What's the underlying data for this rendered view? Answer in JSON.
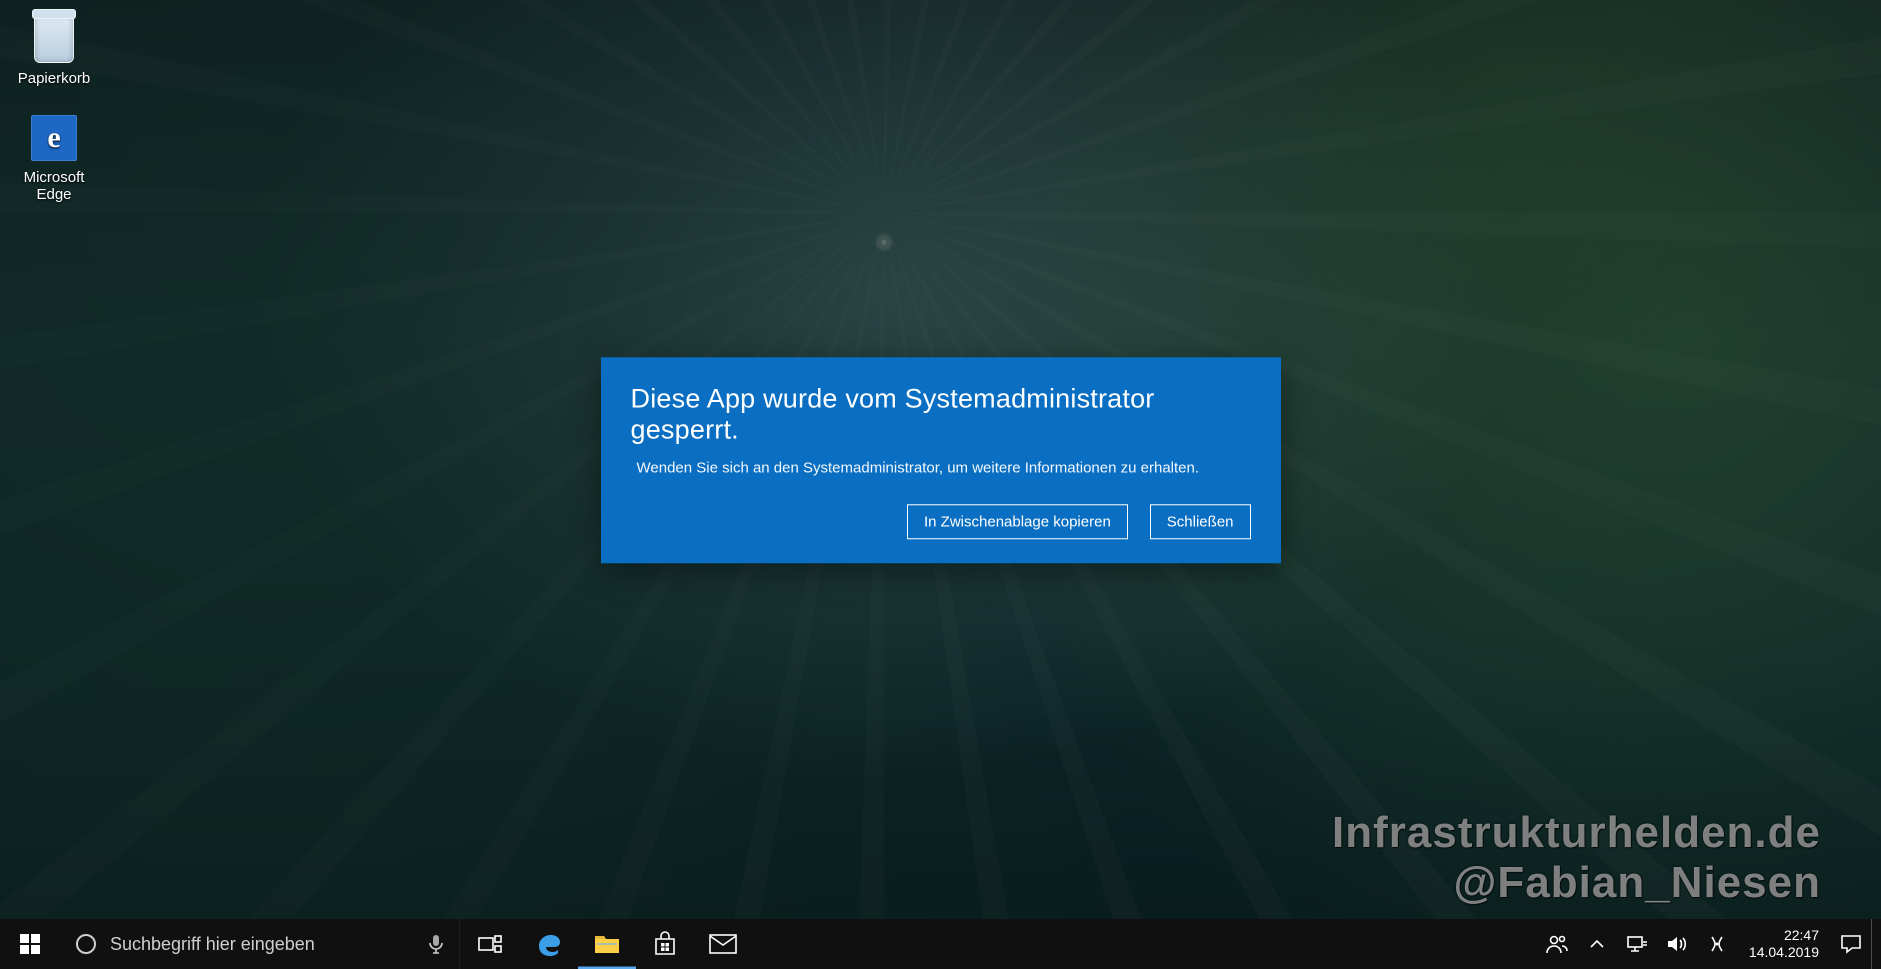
{
  "desktop_icons": {
    "recycle_bin": "Papierkorb",
    "edge": "Microsoft Edge"
  },
  "dialog": {
    "title": "Diese App wurde vom Systemadministrator gesperrt.",
    "message": "Wenden Sie sich an den Systemadministrator, um weitere Informationen zu erhalten.",
    "copy_button": "In Zwischenablage kopieren",
    "close_button": "Schließen"
  },
  "watermark": {
    "line1": "Infrastrukturhelden.de",
    "line2": "@Fabian_Niesen"
  },
  "taskbar": {
    "search_placeholder": "Suchbegriff hier eingeben",
    "clock_time": "22:47",
    "clock_date": "14.04.2019"
  }
}
